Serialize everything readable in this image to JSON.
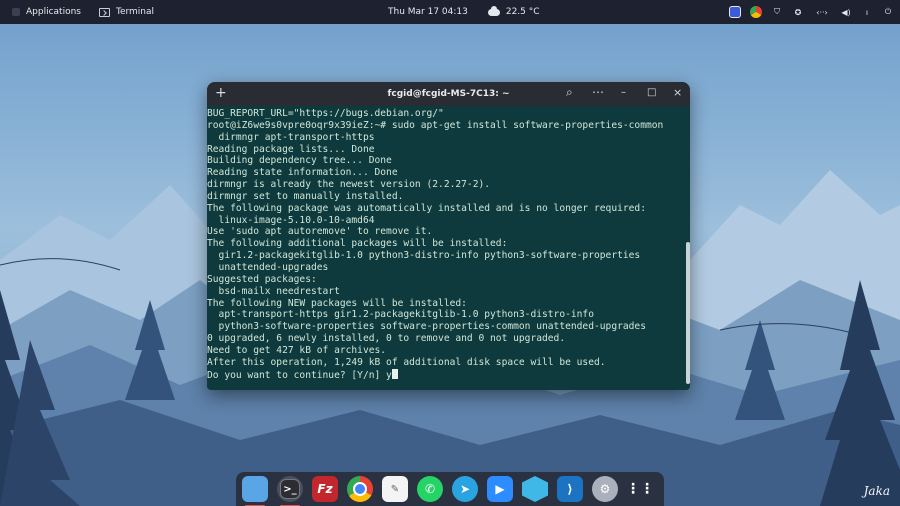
{
  "topbar": {
    "applications_label": "Applications",
    "active_app_label": "Terminal",
    "clock": "Thu Mar 17  04:13",
    "weather": "22.5 °C",
    "tray_icons": [
      "app-indicator-icon",
      "chrome-icon",
      "shield-icon",
      "accessibility-icon",
      "network-icon",
      "volume-icon",
      "microphone-icon",
      "power-icon"
    ]
  },
  "terminal": {
    "title": "fcgid@fcgid-MS-7C13: ~",
    "new_tab_symbol": "+",
    "search_symbol": "⌕",
    "menu_symbol": "⋯",
    "minimize_symbol": "–",
    "maximize_symbol": "□",
    "close_symbol": "×",
    "lines": [
      "BUG_REPORT_URL=\"https://bugs.debian.org/\"",
      "root@iZ6we9s0vpre0oqr9x39ieZ:~# sudo apt-get install software-properties-common",
      "  dirmngr apt-transport-https",
      "Reading package lists... Done",
      "Building dependency tree... Done",
      "Reading state information... Done",
      "dirmngr is already the newest version (2.2.27-2).",
      "dirmngr set to manually installed.",
      "The following package was automatically installed and is no longer required:",
      "  linux-image-5.10.0-10-amd64",
      "Use 'sudo apt autoremove' to remove it.",
      "The following additional packages will be installed:",
      "  gir1.2-packagekitglib-1.0 python3-distro-info python3-software-properties",
      "  unattended-upgrades",
      "Suggested packages:",
      "  bsd-mailx needrestart",
      "The following NEW packages will be installed:",
      "  apt-transport-https gir1.2-packagekitglib-1.0 python3-distro-info",
      "  python3-software-properties software-properties-common unattended-upgrades",
      "0 upgraded, 6 newly installed, 0 to remove and 0 not upgraded.",
      "Need to get 427 kB of archives.",
      "After this operation, 1,249 kB of additional disk space will be used.",
      "Do you want to continue? [Y/n] y"
    ]
  },
  "dock": {
    "apps": [
      {
        "name": "files",
        "glyph": ""
      },
      {
        "name": "terminal",
        "glyph": ">_"
      },
      {
        "name": "filezilla",
        "glyph": "Fz"
      },
      {
        "name": "chrome",
        "glyph": ""
      },
      {
        "name": "text-editor",
        "glyph": "✎"
      },
      {
        "name": "whatsapp",
        "glyph": "✆"
      },
      {
        "name": "telegram",
        "glyph": "➤"
      },
      {
        "name": "zoom",
        "glyph": "▶"
      },
      {
        "name": "hex-app",
        "glyph": "⬡"
      },
      {
        "name": "vscode",
        "glyph": "⟩"
      },
      {
        "name": "settings",
        "glyph": "⚙"
      },
      {
        "name": "app-grid",
        "glyph": "⋮⋮⋮"
      }
    ]
  },
  "signature": "Jaka"
}
